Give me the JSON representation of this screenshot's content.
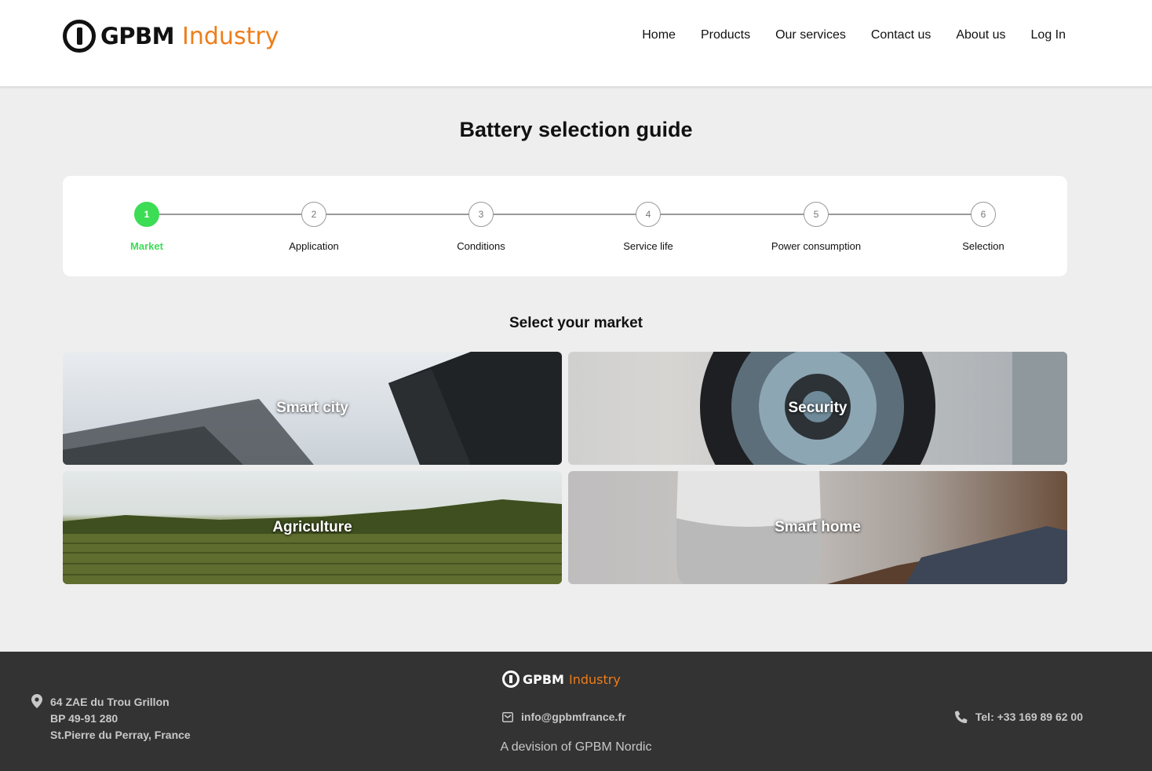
{
  "brand": {
    "name": "GPBM",
    "suffix": "Industry"
  },
  "nav": [
    "Home",
    "Products",
    "Our services",
    "Contact us",
    "About us",
    "Log In"
  ],
  "page_title": "Battery selection guide",
  "stepper": {
    "active_step": 1,
    "steps": [
      {
        "number": "1",
        "label": "Market"
      },
      {
        "number": "2",
        "label": "Application"
      },
      {
        "number": "3",
        "label": "Conditions"
      },
      {
        "number": "4",
        "label": "Service life"
      },
      {
        "number": "5",
        "label": "Power consumption"
      },
      {
        "number": "6",
        "label": "Selection"
      }
    ]
  },
  "markets": {
    "title": "Select your market",
    "items": [
      "Smart city",
      "Security",
      "Agriculture",
      "Smart home"
    ]
  },
  "footer": {
    "brand": {
      "name": "GPBM",
      "suffix": "Industry"
    },
    "address": [
      "64 ZAE du Trou Grillon",
      "BP 49-91 280",
      "St.Pierre du Perray, France"
    ],
    "email": "info@gpbmfrance.fr",
    "phone": "Tel: +33 169 89 62 00",
    "division": "A devision of GPBM Nordic",
    "icons": {
      "address": "map-pin-icon",
      "email": "envelope-icon",
      "phone": "phone-icon"
    }
  },
  "colors": {
    "accent": "#3ddc55",
    "brand_orange": "#ef7d1a",
    "footer_bg": "#333333"
  }
}
